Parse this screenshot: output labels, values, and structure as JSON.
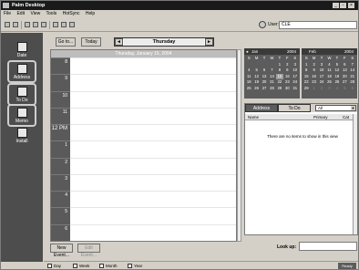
{
  "window": {
    "title": "Palm Desktop"
  },
  "menu": [
    "File",
    "Edit",
    "View",
    "Tools",
    "HotSync",
    "Help"
  ],
  "toolbar": {
    "user_label": "User:",
    "user_value": "CLE"
  },
  "launcher": {
    "items": [
      {
        "label": "Date",
        "icon": "calendar-icon",
        "selected": false
      },
      {
        "label": "Address",
        "icon": "address-book-icon",
        "selected": true
      },
      {
        "label": "To Do",
        "icon": "todo-checklist-icon",
        "selected": true
      },
      {
        "label": "Memo",
        "icon": "memo-pencil-icon",
        "selected": true
      },
      {
        "label": "Install",
        "icon": "install-icon",
        "selected": false
      }
    ]
  },
  "dayview": {
    "goto_label": "Go to...",
    "today_label": "Today",
    "day_label": "Thursday",
    "date_header": "Thursday, January 15, 2004",
    "times": [
      "8",
      "9",
      "10",
      "11",
      "12",
      "1",
      "2",
      "3",
      "4",
      "5",
      "6"
    ],
    "noon_suffix": "PM",
    "new_event_label": "New Event...",
    "edit_event_label": "Edit Event..."
  },
  "calendar": {
    "left": {
      "month": "Jan",
      "year": "2004",
      "dow": [
        "S",
        "M",
        "T",
        "W",
        "T",
        "F",
        "S"
      ],
      "days": [
        "",
        "",
        "",
        "",
        "1",
        "2",
        "3",
        "4",
        "5",
        "6",
        "7",
        "8",
        "9",
        "10",
        "11",
        "12",
        "13",
        "14",
        "15",
        "16",
        "17",
        "18",
        "19",
        "20",
        "21",
        "22",
        "23",
        "24",
        "25",
        "26",
        "27",
        "28",
        "29",
        "30",
        "31"
      ],
      "today": "15"
    },
    "right": {
      "month": "Feb",
      "year": "2004",
      "dow": [
        "S",
        "M",
        "T",
        "W",
        "T",
        "F",
        "S"
      ],
      "days": [
        "1",
        "2",
        "3",
        "4",
        "5",
        "6",
        "7",
        "8",
        "9",
        "10",
        "11",
        "12",
        "13",
        "14",
        "15",
        "16",
        "17",
        "18",
        "19",
        "20",
        "21",
        "22",
        "23",
        "24",
        "25",
        "26",
        "27",
        "28",
        "29",
        "1",
        "2",
        "3",
        "4",
        "5",
        "6"
      ]
    }
  },
  "address_panel": {
    "tabs": [
      "Address",
      "To Do"
    ],
    "filter": "All",
    "columns": [
      "Name",
      "Primary",
      "Cat"
    ],
    "empty_text": "There are no items to show in this view"
  },
  "lookup": {
    "label": "Look up:"
  },
  "view_tabs": [
    "Day",
    "Week",
    "Month",
    "Year"
  ],
  "status": {
    "label": "Ready"
  }
}
